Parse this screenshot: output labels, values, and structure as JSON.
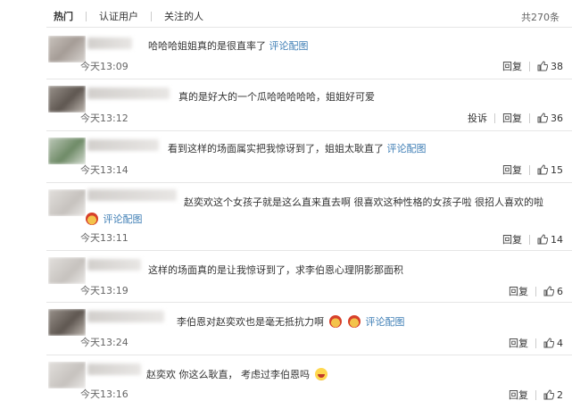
{
  "tabs": [
    "热门",
    "认证用户",
    "关注的人"
  ],
  "total": "共270条",
  "comments": [
    {
      "text": "哈哈哈姐姐真的是很直率了",
      "link": "评论配图",
      "time": "今天13:09",
      "reply": "回复",
      "likes": "38"
    },
    {
      "text": "真的是好大的一个瓜哈哈哈哈哈，姐姐好可爱",
      "time": "今天13:12",
      "report": "投诉",
      "reply": "回复",
      "likes": "36"
    },
    {
      "text": "看到这样的场面属实把我惊讶到了，姐姐太耿直了",
      "link": "评论配图",
      "time": "今天13:14",
      "reply": "回复",
      "likes": "15"
    },
    {
      "text": "赵奕欢这个女孩子就是这么直来直去啊 很喜欢这种性格的女孩子啦 很招人喜欢的啦",
      "link": "评论配图",
      "time": "今天13:11",
      "reply": "回复",
      "likes": "14"
    },
    {
      "text": "这样的场面真的是让我惊讶到了，求李伯恩心理阴影那面积",
      "time": "今天13:19",
      "reply": "回复",
      "likes": "6"
    },
    {
      "text": "李伯恩对赵奕欢也是毫无抵抗力啊",
      "link": "评论配图",
      "time": "今天13:24",
      "reply": "回复",
      "likes": "4"
    },
    {
      "text": "赵奕欢 你这么耿直， 考虑过李伯恩吗",
      "time": "今天13:16",
      "reply": "回复",
      "likes": "2"
    }
  ]
}
